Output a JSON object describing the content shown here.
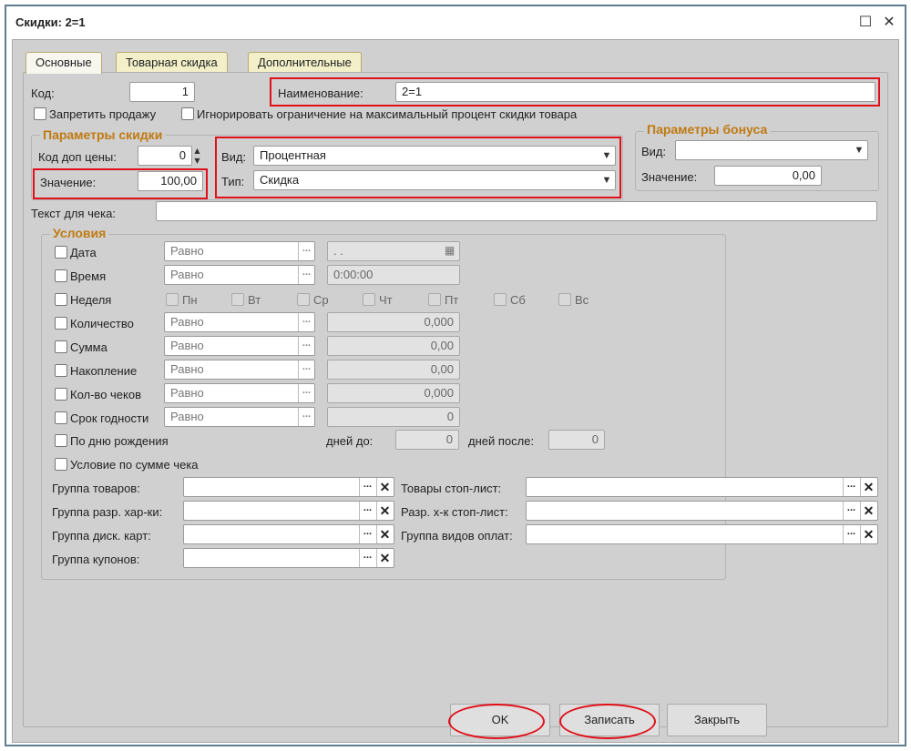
{
  "window": {
    "title": "Скидки: 2=1"
  },
  "tabs": [
    "Основные",
    "Товарная скидка",
    "Дополнительные"
  ],
  "main": {
    "kod_label": "Код:",
    "kod_value": "1",
    "name_label": "Наименование:",
    "name_value": "2=1",
    "forbid_sale": "Запретить продажу",
    "ignore_limit": "Игнорировать ограничение на максимальный процент скидки товара",
    "check_text_label": "Текст для чека:"
  },
  "params": {
    "title": "Параметры скидки",
    "price_code_label": "Код доп цены:",
    "price_code_value": "0",
    "value_label": "Значение:",
    "value_value": "100,00",
    "vid_label": "Вид:",
    "vid_value": "Процентная",
    "tip_label": "Тип:",
    "tip_value": "Скидка"
  },
  "bonus": {
    "title": "Параметры бонуса",
    "vid_label": "Вид:",
    "vid_value": "",
    "value_label": "Значение:",
    "value_value": "0,00"
  },
  "conditions": {
    "title": "Условия",
    "rows": [
      {
        "label": "Дата",
        "op": "Равно",
        "value": "  .  .",
        "cal": true
      },
      {
        "label": "Время",
        "op": "Равно",
        "value": "0:00:00"
      },
      {
        "label": "Количество",
        "op": "Равно",
        "value": "0,000"
      },
      {
        "label": "Сумма",
        "op": "Равно",
        "value": "0,00"
      },
      {
        "label": "Накопление",
        "op": "Равно",
        "value": "0,00"
      },
      {
        "label": "Кол-во чеков",
        "op": "Равно",
        "value": "0,000"
      },
      {
        "label": "Срок годности",
        "op": "Равно",
        "value": "0"
      }
    ],
    "week": {
      "label": "Неделя",
      "days": [
        "Пн",
        "Вт",
        "Ср",
        "Чт",
        "Пт",
        "Сб",
        "Вс"
      ]
    },
    "birthday": {
      "label": "По дню рождения",
      "before_label": "дней до:",
      "before_value": "0",
      "after_label": "дней после:",
      "after_value": "0"
    },
    "check_sum": "Условие по сумме чека",
    "groups_left": [
      "Группа товаров:",
      "Группа разр. хар-ки:",
      "Группа диск. карт:",
      "Группа купонов:"
    ],
    "groups_right": [
      "Товары стоп-лист:",
      "Разр. х-к стоп-лист:",
      "Группа видов оплат:"
    ]
  },
  "buttons": {
    "ok": "OK",
    "save": "Записать",
    "close": "Закрыть"
  },
  "colors": {
    "accent": "#c07a12",
    "highlight": "#e0101a"
  }
}
